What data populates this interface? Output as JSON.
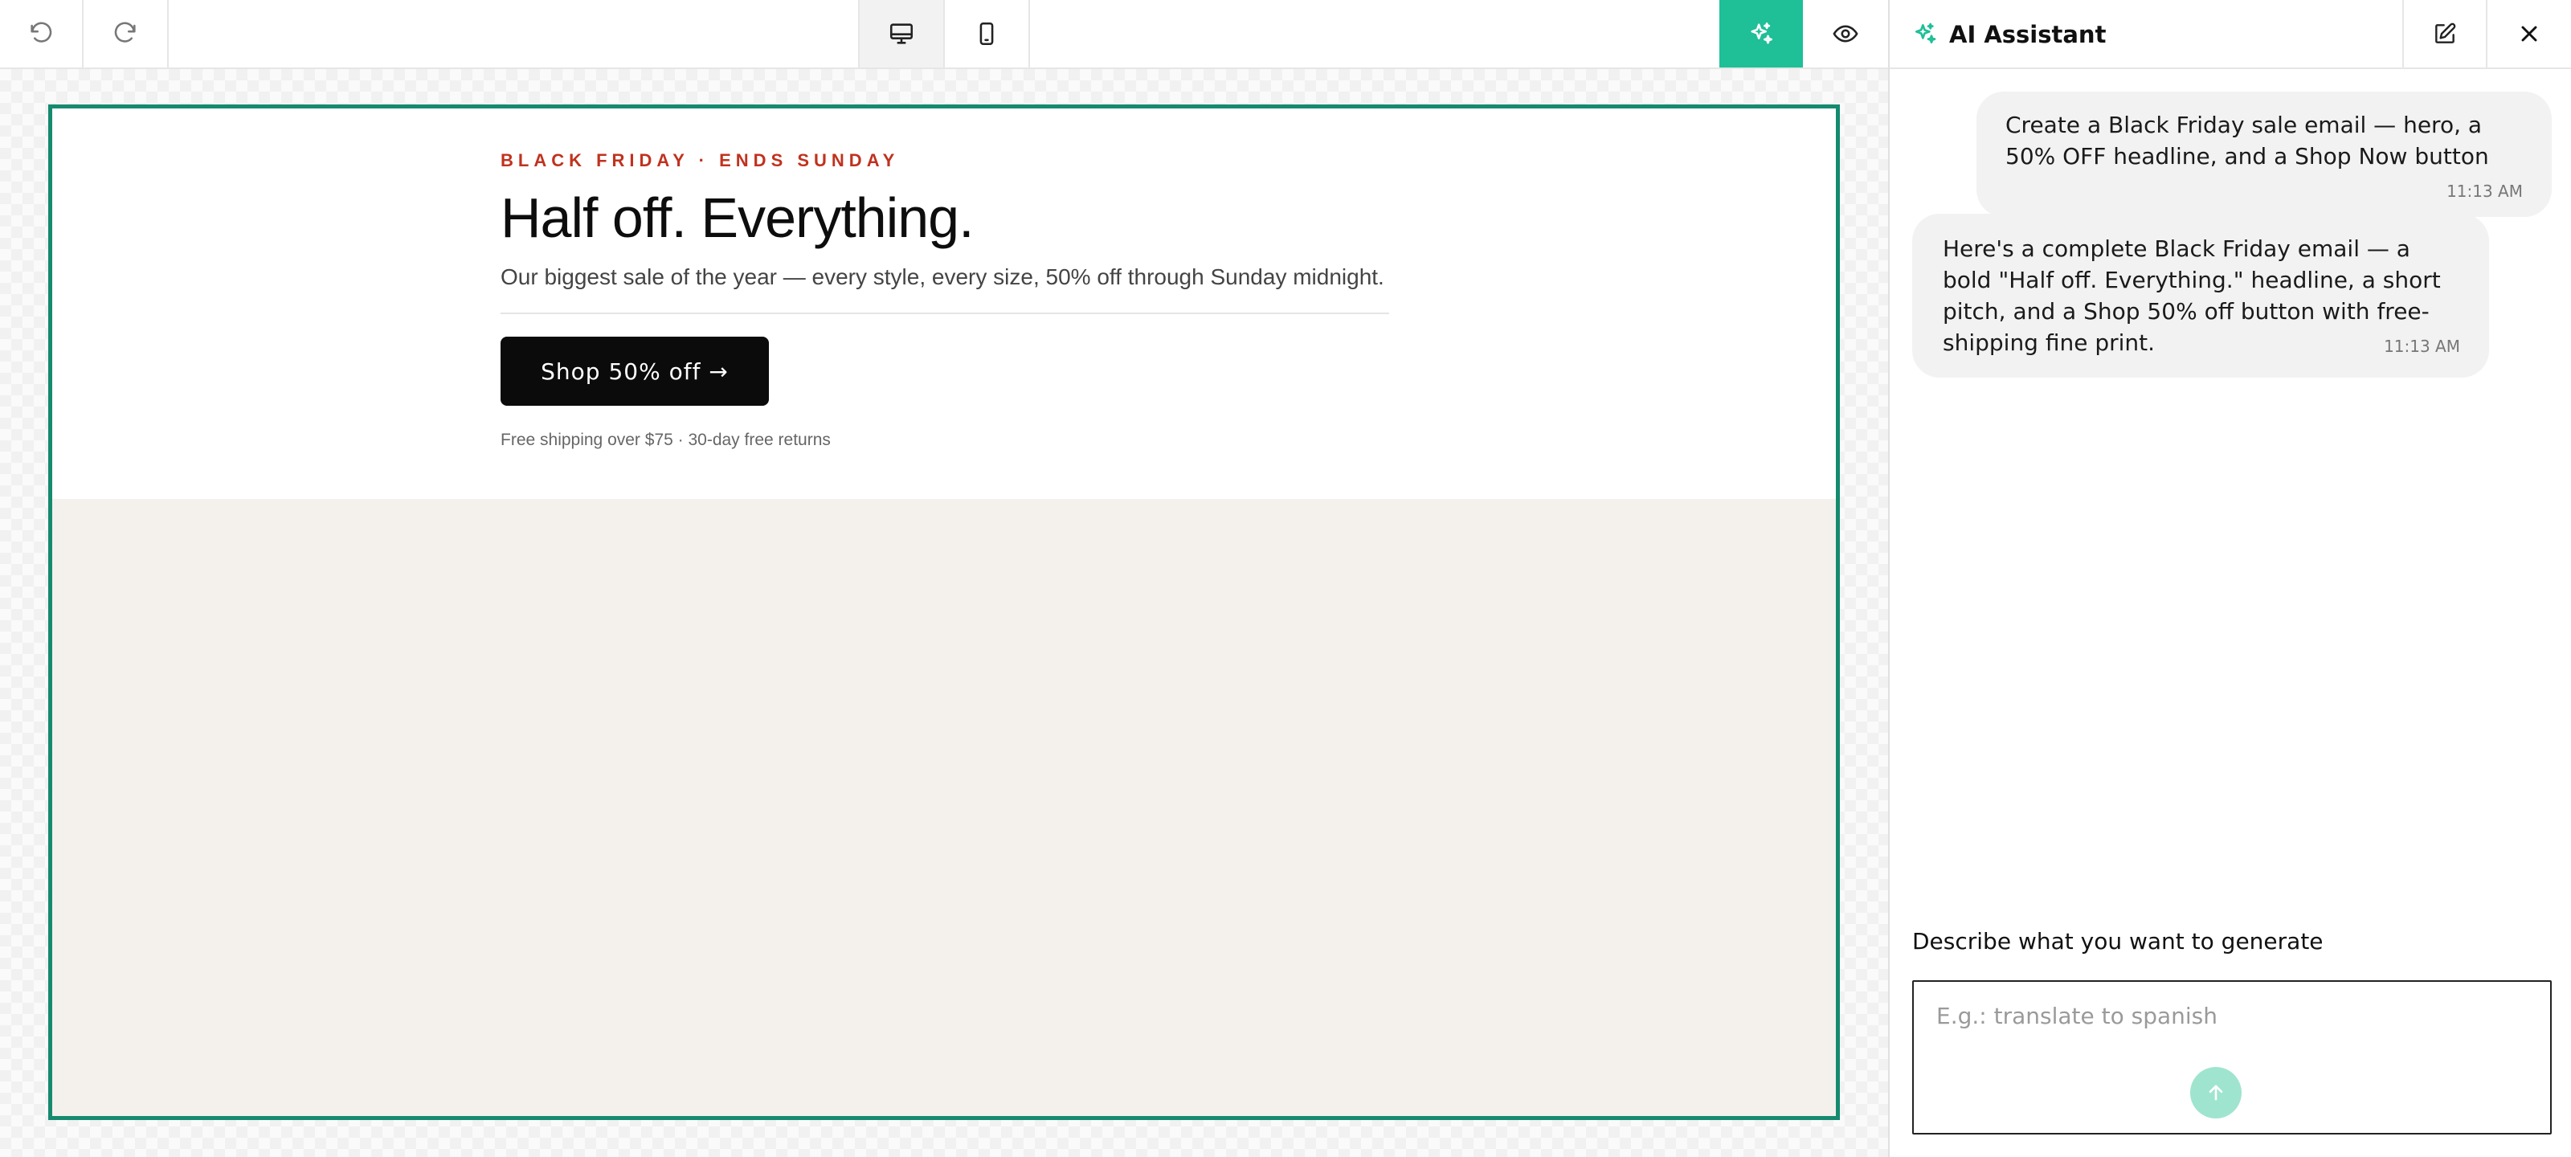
{
  "colors": {
    "accent": "#1fbf97",
    "frame_border": "#168a6f",
    "eyebrow": "#c0321e",
    "cta_background": "#0b0b0b",
    "email_background": "#f4f1ec"
  },
  "toolbar": {
    "icons": [
      "undo-icon",
      "redo-icon",
      "desktop-icon",
      "mobile-icon",
      "ai-sparkle-icon",
      "eye-icon"
    ],
    "active_view": "desktop"
  },
  "email": {
    "eyebrow": "BLACK FRIDAY · ENDS SUNDAY",
    "headline": "Half off. Everything.",
    "subline": "Our biggest sale of the year — every style, every size, 50% off through Sunday midnight.",
    "cta_label": "Shop 50% off →",
    "fine_print": "Free shipping over $75 · 30-day free returns"
  },
  "panel": {
    "title": "AI Assistant",
    "icons": [
      "sparkle-icon",
      "edit-icon",
      "close-icon"
    ],
    "messages": [
      {
        "role": "user",
        "text": "Create a Black Friday sale email — hero, a 50% OFF headline, and a Shop Now button",
        "time": "11:13 AM"
      },
      {
        "role": "assistant",
        "text": "Here's a complete Black Friday email — a bold \"Half off. Everything.\" headline, a short pitch, and a Shop 50% off button with free-shipping fine print.",
        "time": "11:13 AM"
      }
    ],
    "prompt_label": "Describe what you want to generate",
    "prompt_placeholder": "E.g.: translate to spanish",
    "prompt_value": ""
  }
}
